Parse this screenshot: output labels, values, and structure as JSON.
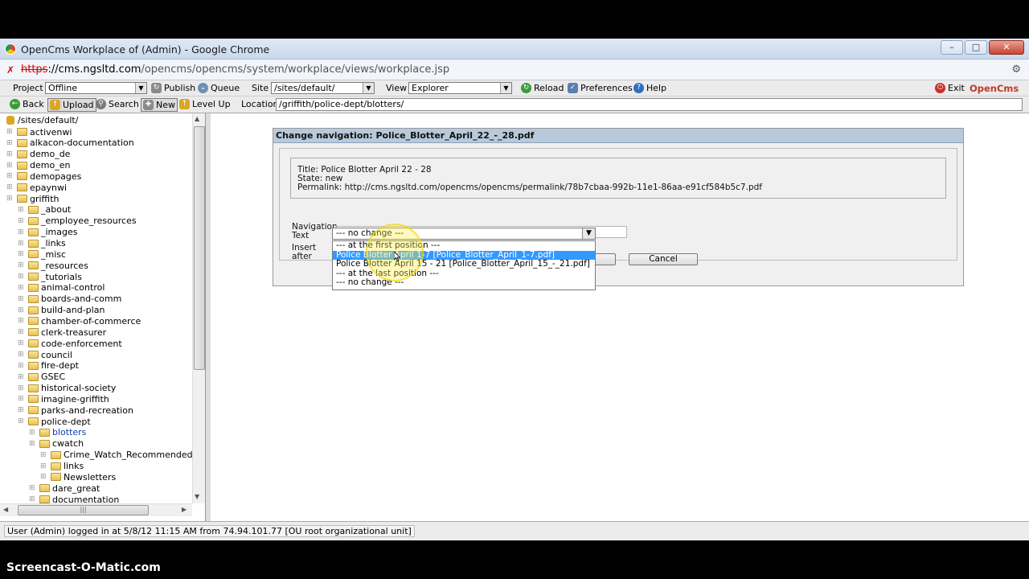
{
  "window": {
    "title": "OpenCms Workplace of (Admin) - Google Chrome"
  },
  "address": {
    "proto": "https",
    "host": "://cms.ngsltd.com",
    "path": "/opencms/opencms/system/workplace/views/workplace.jsp"
  },
  "toolbar1": {
    "project_label": "Project",
    "project_value": "Offline",
    "publish": "Publish",
    "queue": "Queue",
    "site_label": "Site",
    "site_value": "/sites/default/",
    "view_label": "View",
    "view_value": "Explorer",
    "reload": "Reload",
    "preferences": "Preferences",
    "help": "Help",
    "exit": "Exit",
    "brand": "OpenCms"
  },
  "toolbar2": {
    "back": "Back",
    "upload": "Upload",
    "search": "Search",
    "new": "New",
    "level_up": "Level Up",
    "location_label": "Location",
    "location_value": "/griffith/police-dept/blotters/"
  },
  "tree": {
    "root": "/sites/default/",
    "items": [
      {
        "label": "activenwi",
        "depth": 0
      },
      {
        "label": "alkacon-documentation",
        "depth": 0
      },
      {
        "label": "demo_de",
        "depth": 0
      },
      {
        "label": "demo_en",
        "depth": 0
      },
      {
        "label": "demopages",
        "depth": 0
      },
      {
        "label": "epaynwi",
        "depth": 0
      },
      {
        "label": "griffith",
        "depth": 0
      },
      {
        "label": "_about",
        "depth": 1
      },
      {
        "label": "_employee_resources",
        "depth": 1
      },
      {
        "label": "_images",
        "depth": 1
      },
      {
        "label": "_links",
        "depth": 1
      },
      {
        "label": "_misc",
        "depth": 1
      },
      {
        "label": "_resources",
        "depth": 1
      },
      {
        "label": "_tutorials",
        "depth": 1
      },
      {
        "label": "animal-control",
        "depth": 1
      },
      {
        "label": "boards-and-comm",
        "depth": 1
      },
      {
        "label": "build-and-plan",
        "depth": 1
      },
      {
        "label": "chamber-of-commerce",
        "depth": 1
      },
      {
        "label": "clerk-treasurer",
        "depth": 1
      },
      {
        "label": "code-enforcement",
        "depth": 1
      },
      {
        "label": "council",
        "depth": 1
      },
      {
        "label": "fire-dept",
        "depth": 1
      },
      {
        "label": "GSEC",
        "depth": 1
      },
      {
        "label": "historical-society",
        "depth": 1
      },
      {
        "label": "imagine-griffith",
        "depth": 1
      },
      {
        "label": "parks-and-recreation",
        "depth": 1
      },
      {
        "label": "police-dept",
        "depth": 1
      },
      {
        "label": "blotters",
        "depth": 2,
        "selected": true
      },
      {
        "label": "cwatch",
        "depth": 2
      },
      {
        "label": "Crime_Watch_Recommended_D",
        "depth": 3
      },
      {
        "label": "links",
        "depth": 3
      },
      {
        "label": "Newsletters",
        "depth": 3
      },
      {
        "label": "dare_great",
        "depth": 2
      },
      {
        "label": "documentation",
        "depth": 2
      }
    ]
  },
  "dialog": {
    "title": "Change navigation: Police_Blotter_April_22_-_28.pdf",
    "info_title": "Title: Police Blotter April 22 - 28",
    "info_state": "State: new",
    "info_permalink": "Permalink: http://cms.ngsltd.com/opencms/opencms/permalink/78b7cbaa-992b-11e1-86aa-e91cf584b5c7.pdf",
    "nav_label_1": "Navigation",
    "nav_label_2": "Text",
    "nav_value": "",
    "insert_label_1": "Insert",
    "insert_label_2": "after",
    "insert_selected": "--- no change ---",
    "insert_options": [
      "--- at the first position ---",
      "Police Blotter April 1-7 [Police_Blotter_April_1-7.pdf]",
      "Police Blotter April 15 - 21 [Police_Blotter_April_15_-_21.pdf]",
      "--- at the last position ---",
      "--- no change ---"
    ],
    "highlighted_option": 1,
    "ok": "",
    "cancel": "Cancel"
  },
  "status": {
    "text": "User (Admin) logged in at 5/8/12 11:15 AM from 74.94.101.77 [OU root organizational unit]"
  },
  "watermark": "Screencast-O-Matic.com"
}
